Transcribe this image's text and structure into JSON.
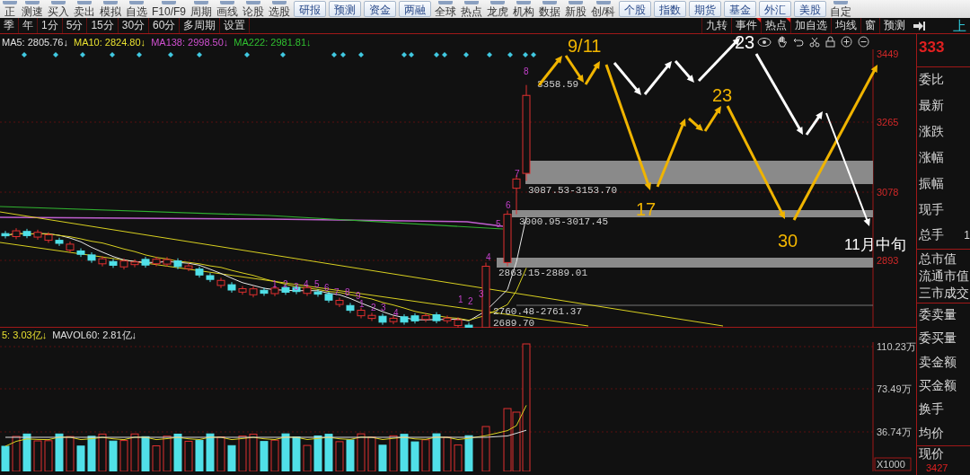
{
  "toolbar": [
    {
      "label": "正",
      "kind": "tool"
    },
    {
      "label": "测速",
      "kind": "tool"
    },
    {
      "label": "买入",
      "kind": "tool"
    },
    {
      "label": "卖出",
      "kind": "tool"
    },
    {
      "label": "模拟",
      "kind": "tool"
    },
    {
      "label": "自选",
      "kind": "tool"
    },
    {
      "label": "F10/F9",
      "kind": "tool"
    },
    {
      "label": "周期",
      "kind": "tool"
    },
    {
      "label": "画线",
      "kind": "tool"
    },
    {
      "label": "论股",
      "kind": "tool"
    },
    {
      "label": "选股",
      "kind": "tool"
    },
    {
      "label": "研报",
      "kind": "pill"
    },
    {
      "label": "预测",
      "kind": "pill"
    },
    {
      "label": "资金",
      "kind": "pill"
    },
    {
      "label": "两融",
      "kind": "pill"
    },
    {
      "label": "全球",
      "kind": "tool"
    },
    {
      "label": "热点",
      "kind": "tool"
    },
    {
      "label": "龙虎",
      "kind": "tool"
    },
    {
      "label": "机构",
      "kind": "tool"
    },
    {
      "label": "数据",
      "kind": "tool"
    },
    {
      "label": "新股",
      "kind": "tool"
    },
    {
      "label": "创/科",
      "kind": "tool"
    },
    {
      "label": "个股",
      "kind": "pill"
    },
    {
      "label": "指数",
      "kind": "pill"
    },
    {
      "label": "期货",
      "kind": "pill"
    },
    {
      "label": "基金",
      "kind": "pill"
    },
    {
      "label": "外汇",
      "kind": "pill"
    },
    {
      "label": "美股",
      "kind": "pill"
    },
    {
      "label": "自定",
      "kind": "tool"
    }
  ],
  "period_tabs": [
    "季",
    "年",
    "1分",
    "5分",
    "15分",
    "30分",
    "60分",
    "多周期",
    "设置"
  ],
  "chart_tabs": [
    {
      "label": "九转",
      "flag": false
    },
    {
      "label": "事件",
      "flag": true
    },
    {
      "label": "热点",
      "flag": true
    },
    {
      "label": "加自选",
      "flag": false
    },
    {
      "label": "均线",
      "flag": false
    },
    {
      "label": "窗",
      "flag": false
    },
    {
      "label": "预测",
      "flag": false
    }
  ],
  "market": "上",
  "ma_legend": [
    {
      "text": "MA5: 2805.76↓",
      "color": "#e0e0e0"
    },
    {
      "text": "MA10: 2824.80↓",
      "color": "#e8e030"
    },
    {
      "text": "MA138: 2998.50↓",
      "color": "#d050d0"
    },
    {
      "text": "MA222: 2981.81↓",
      "color": "#30c030"
    }
  ],
  "price_levels": [
    "3358.59",
    "3087.53-3153.70",
    "3000.95-3017.45",
    "2863.15-2889.01",
    "2760.48-2761.37",
    "2689.70"
  ],
  "td_counts": [
    "1",
    "2",
    "3",
    "4",
    "5",
    "6",
    "7",
    "8",
    "9",
    "1",
    "2",
    "3",
    "4",
    "1",
    "2",
    "3",
    "4",
    "5",
    "6",
    "7",
    "8"
  ],
  "annotations": [
    {
      "text": "9/11",
      "color": "#f0b400"
    },
    {
      "text": "23",
      "color": "#f0b400"
    },
    {
      "text": "17",
      "color": "#f0b400"
    },
    {
      "text": "30",
      "color": "#f0b400"
    },
    {
      "text": "23",
      "color": "#ffffff"
    },
    {
      "text": "11月中旬",
      "color": "#ffffff"
    }
  ],
  "y_axis": [
    "3449",
    "3265",
    "3078",
    "2893"
  ],
  "vol_legend": [
    {
      "text": "5: 3.03亿↓",
      "color": "#e8e030"
    },
    {
      "text": "MAVOL60: 2.81亿↓",
      "color": "#e0e0e0"
    }
  ],
  "vol_axis": [
    "110.23万",
    "73.49万",
    "36.74万"
  ],
  "vol_unit": "X1000",
  "quote_panel": {
    "price": "333",
    "group_1": [
      "委比",
      "最新",
      "涨跌",
      "涨幅",
      "振幅",
      "现手",
      "总手"
    ],
    "total_hands_value": "1",
    "group_2": [
      "总市值",
      "流通市值",
      "三市成交"
    ],
    "group_3": [
      "委卖量",
      "委买量",
      "卖金额",
      "买金额",
      "换手",
      "均价"
    ],
    "group_4": [
      "现价"
    ],
    "last": "3427"
  }
}
